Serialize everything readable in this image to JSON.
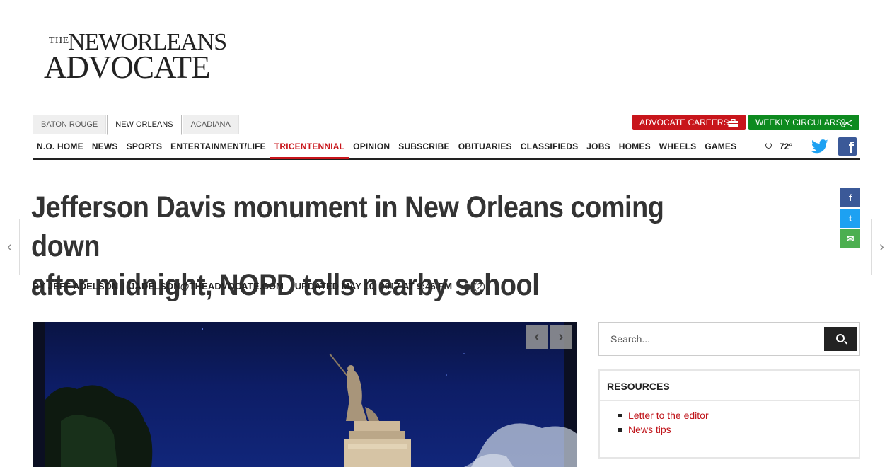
{
  "logo": {
    "line_the": "THE",
    "line_city": "NEWORLEANS",
    "line_paper": "ADVOCATE"
  },
  "city_tabs": [
    {
      "label": "BATON ROUGE"
    },
    {
      "label": "NEW ORLEANS",
      "active": true
    },
    {
      "label": "ACADIANA"
    }
  ],
  "promo_buttons": {
    "careers": {
      "label": "ADVOCATE CAREERS",
      "icon": "briefcase-icon",
      "color": "#c8151b"
    },
    "circulars": {
      "label": "WEEKLY CIRCULARS",
      "icon": "scissors-icon",
      "color": "#0d8a1f"
    }
  },
  "nav": {
    "items": [
      {
        "label": "N.O. HOME"
      },
      {
        "label": "NEWS"
      },
      {
        "label": "SPORTS"
      },
      {
        "label": "ENTERTAINMENT/LIFE"
      },
      {
        "label": "TRICENTENNIAL",
        "highlight": true
      },
      {
        "label": "OPINION"
      },
      {
        "label": "SUBSCRIBE"
      },
      {
        "label": "OBITUARIES"
      },
      {
        "label": "CLASSIFIEDS"
      },
      {
        "label": "JOBS"
      },
      {
        "label": "HOMES"
      },
      {
        "label": "WHEELS"
      },
      {
        "label": "GAMES"
      }
    ],
    "weather": {
      "icon": "weather-icon",
      "temp": "72°"
    },
    "social": [
      "twitter-icon",
      "facebook-icon"
    ]
  },
  "article": {
    "headline_line1": "Jefferson Davis monument in New Orleans coming down",
    "headline_line2": "after midnight, NOPD tells nearby school",
    "byline_author": "BY JEFF ADELSON",
    "byline_email": "JADELSON@THEADVOCATE.COM",
    "updated": "UPDATED MAY 10, 2017 AT 9:46 PM",
    "comments": "(2)"
  },
  "share_buttons": [
    {
      "icon": "facebook-icon",
      "glyph": "f",
      "color": "#3b5998"
    },
    {
      "icon": "twitter-icon",
      "glyph": "t",
      "color": "#1da1f2"
    },
    {
      "icon": "email-icon",
      "glyph": "✉",
      "color": "#4caf50"
    }
  ],
  "gallery": {
    "prev": "‹",
    "next": "›"
  },
  "side_arrows": {
    "prev": "‹",
    "next": "›"
  },
  "search": {
    "placeholder": "Search..."
  },
  "resources": {
    "title": "RESOURCES",
    "links": [
      {
        "label": "Letter to the editor"
      },
      {
        "label": "News tips"
      }
    ],
    "link_color": "#c0151b"
  }
}
